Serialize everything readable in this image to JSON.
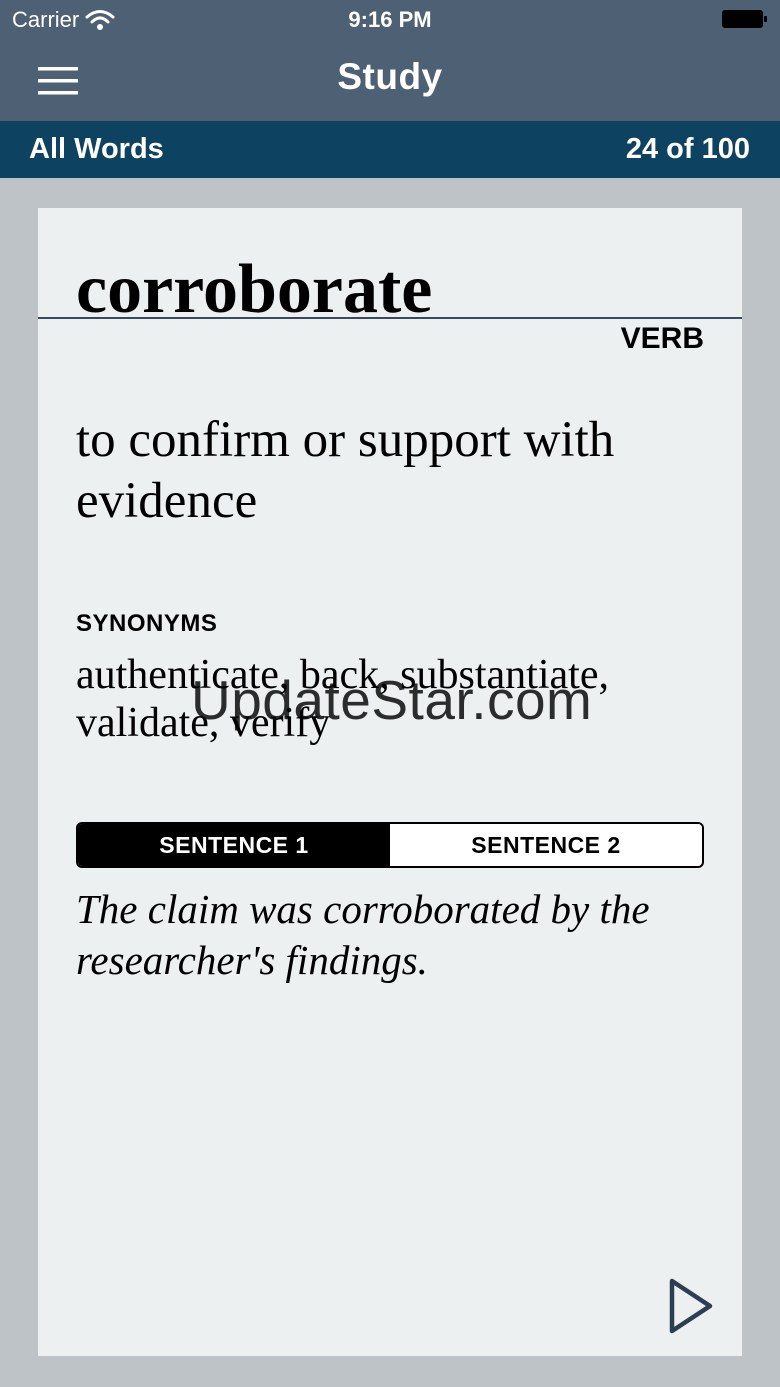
{
  "status_bar": {
    "carrier": "Carrier",
    "time": "9:16 PM"
  },
  "nav": {
    "title": "Study",
    "menu_icon": "hamburger-menu-icon"
  },
  "subheader": {
    "list_name": "All Words",
    "progress": "24 of 100",
    "progress_current": 24,
    "progress_total": 100
  },
  "card": {
    "word": "corroborate",
    "part_of_speech": "VERB",
    "definition": "to confirm or support with evidence",
    "synonyms_label": "SYNONYMS",
    "synonyms": "authenticate, back, substantiate, validate, verify",
    "sentence_tabs": [
      {
        "label": "SENTENCE 1",
        "selected": true
      },
      {
        "label": "SENTENCE 2",
        "selected": false
      }
    ],
    "sentence": "The claim was corroborated by the researcher's findings.",
    "play_icon": "play-icon"
  },
  "watermark": "UpdateStar.com",
  "colors": {
    "header_bg": "#4e6073",
    "subheader_bg": "#0e4261",
    "page_bg": "#bdc3c7",
    "card_bg": "#ecf0f1"
  }
}
